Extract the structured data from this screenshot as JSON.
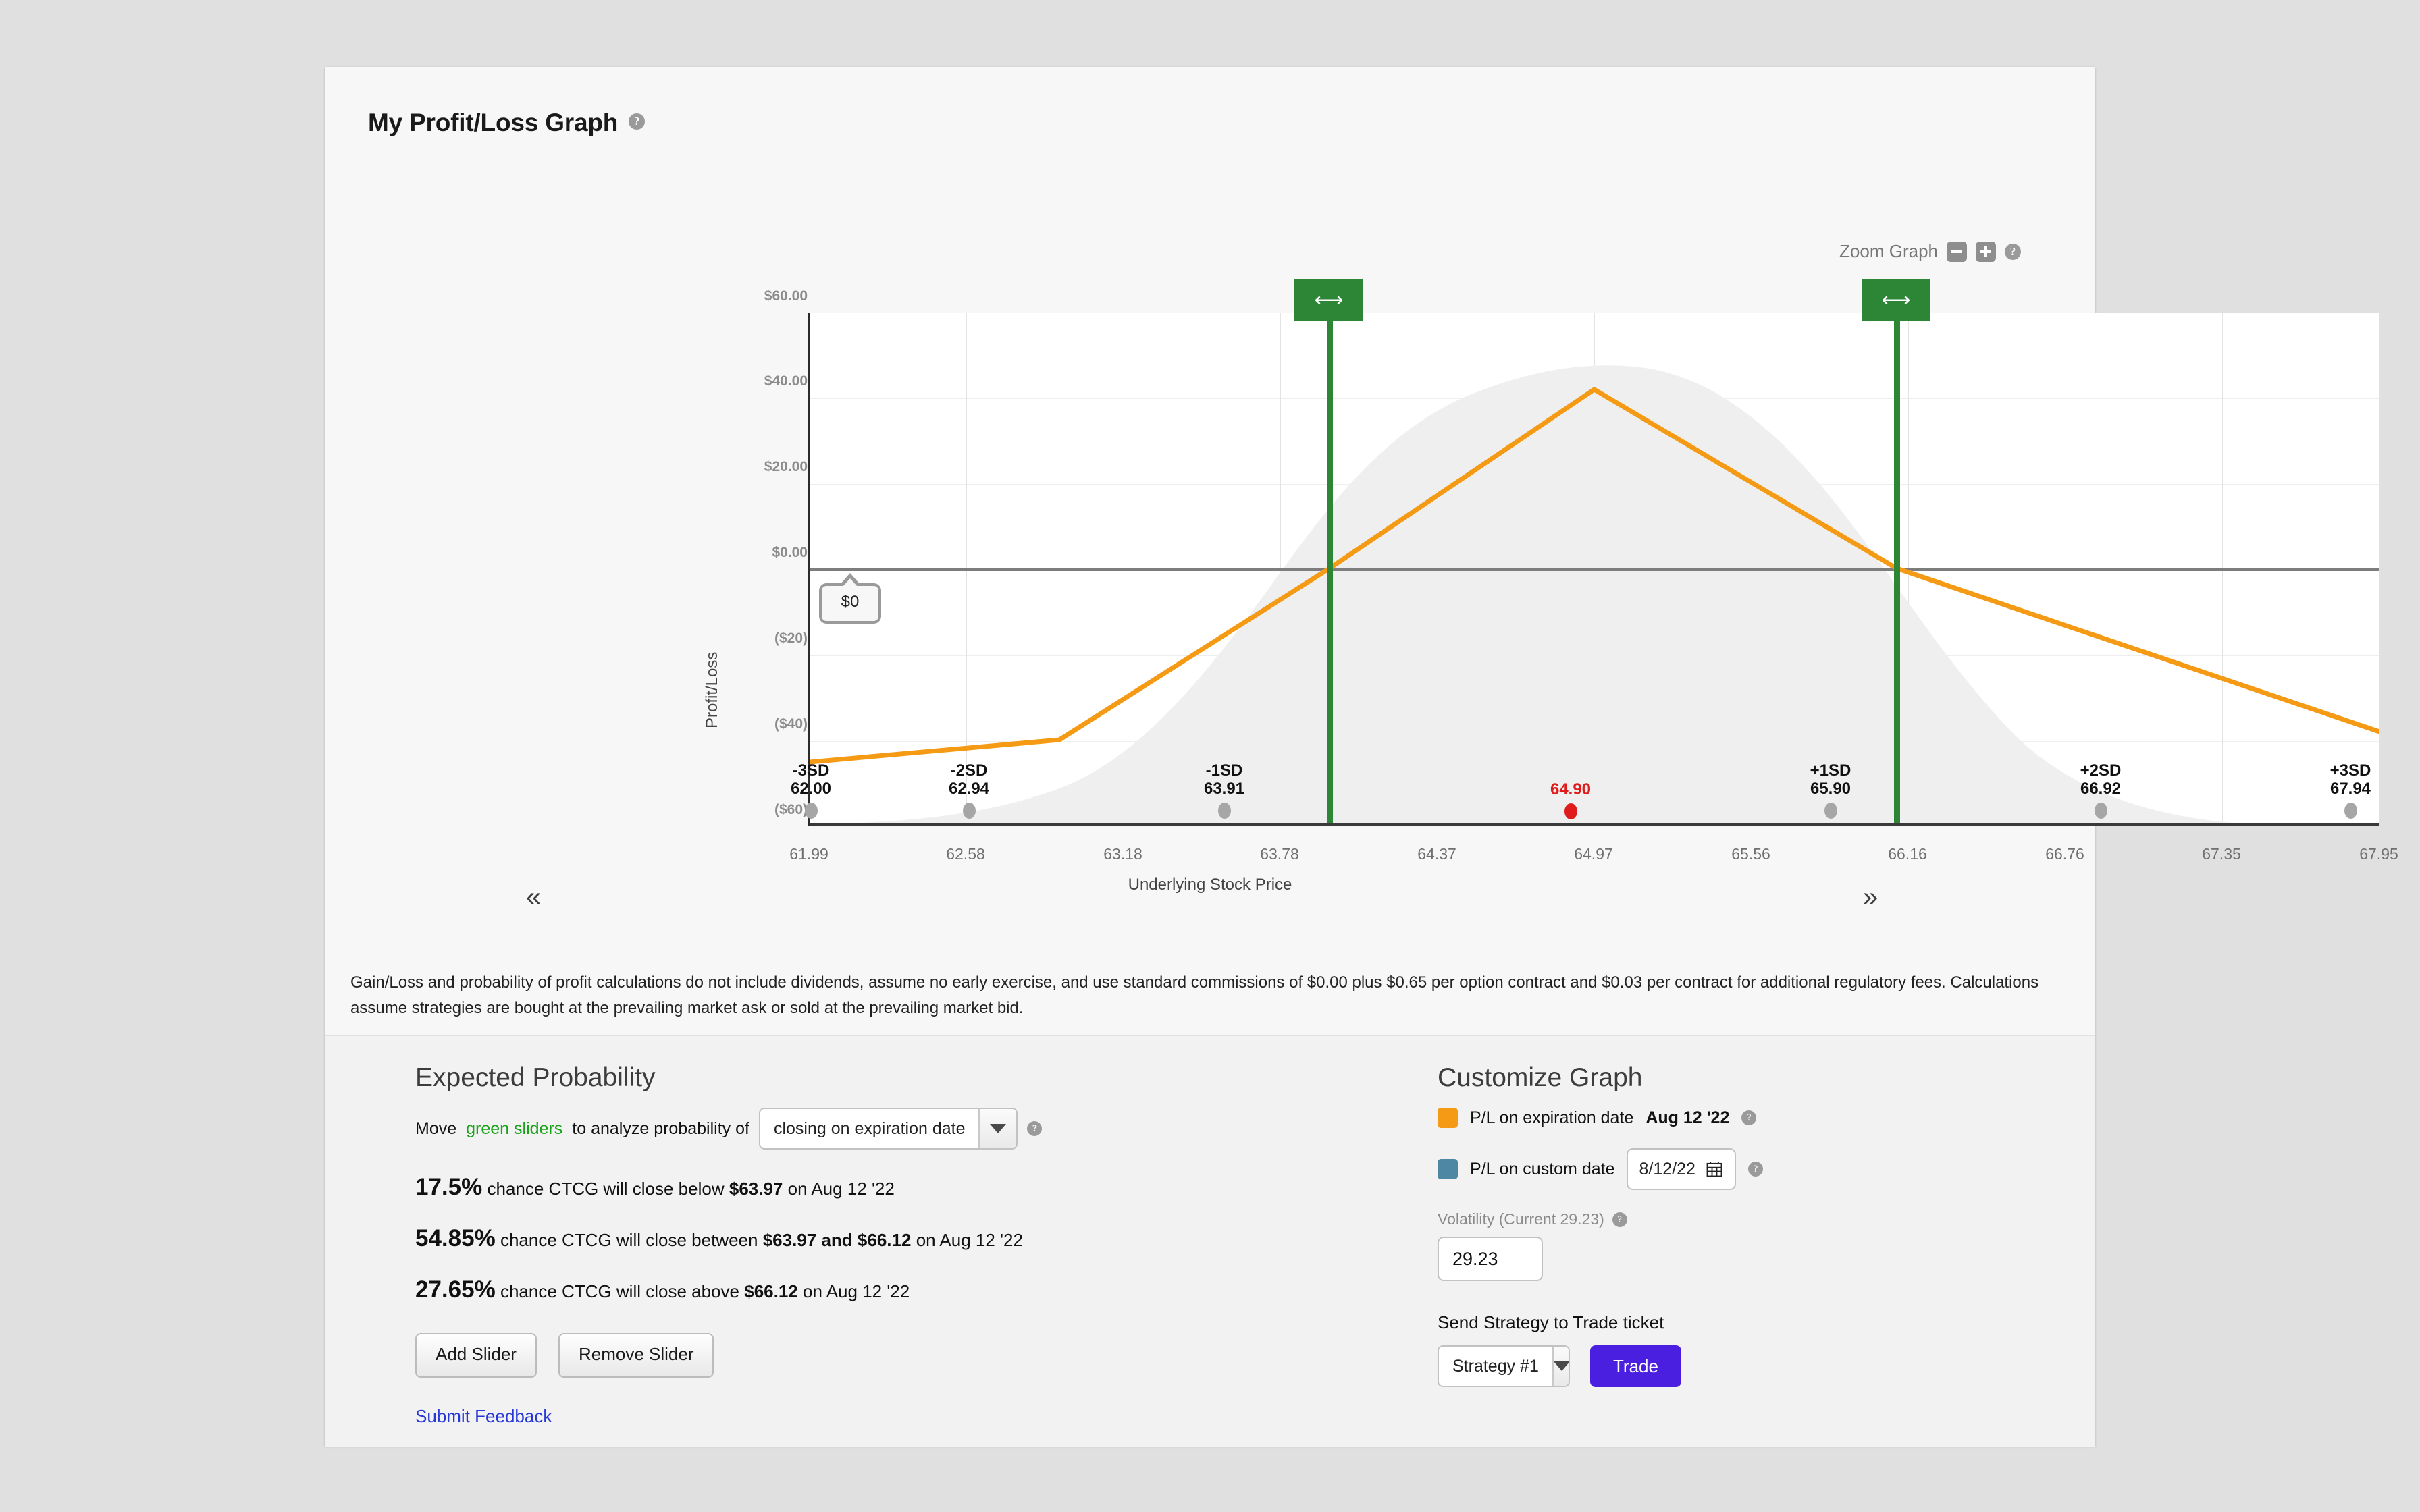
{
  "header": {
    "title": "My Profit/Loss Graph",
    "help_icon": "question-mark-icon",
    "zoom_label": "Zoom Graph",
    "zoom_out_icon": "minus-icon",
    "zoom_in_icon": "plus-icon",
    "zoom_help_icon": "question-mark-icon"
  },
  "chart_data": {
    "type": "line",
    "title": "My Profit/Loss Graph",
    "xlabel": "Underlying Stock Price",
    "ylabel": "Profit/Loss",
    "xlim": [
      61.99,
      67.95
    ],
    "ylim": [
      -60,
      60
    ],
    "grid": true,
    "legend_position": "right-panel",
    "x_ticks": [
      "61.99",
      "62.58",
      "63.18",
      "63.78",
      "64.37",
      "64.97",
      "65.56",
      "66.16",
      "66.76",
      "67.35",
      "67.95"
    ],
    "y_ticks": [
      "$60.00",
      "$40.00",
      "$20.00",
      "$0.00",
      "($20)",
      "($40)",
      "($60)"
    ],
    "y_tick_values": [
      60,
      40,
      20,
      0,
      -20,
      -40,
      -60
    ],
    "zero_callout": "$0",
    "series": [
      {
        "name": "P/L on expiration date Aug 12 '22",
        "color": "#f59a14",
        "x": [
          61.99,
          62.94,
          63.97,
          64.97,
          66.12,
          67.94
        ],
        "values": [
          -45,
          -31,
          0,
          42,
          0,
          -38
        ]
      }
    ],
    "distribution": {
      "name": "probability distribution",
      "color": "#efefef",
      "mean": 64.9,
      "sd": 0.99
    },
    "sd_markers": [
      {
        "label": "-3SD",
        "price": "62.00",
        "current": false
      },
      {
        "label": "-2SD",
        "price": "62.94",
        "current": false
      },
      {
        "label": "-1SD",
        "price": "63.91",
        "current": false
      },
      {
        "label": "",
        "price": "64.90",
        "current": true
      },
      {
        "label": "+1SD",
        "price": "65.90",
        "current": false
      },
      {
        "label": "+2SD",
        "price": "66.92",
        "current": false
      },
      {
        "label": "+3SD",
        "price": "67.94",
        "current": false
      }
    ],
    "sliders": [
      {
        "name": "lower-slider",
        "price": 63.97,
        "color": "#2d8636",
        "icon": "horizontal-resize-icon"
      },
      {
        "name": "upper-slider",
        "price": 66.12,
        "color": "#2d8636",
        "icon": "horizontal-resize-icon"
      }
    ],
    "nav_prev_icon": "«",
    "nav_next_icon": "»"
  },
  "disclaimer": "Gain/Loss and probability of profit calculations do not include dividends, assume no early exercise, and use standard commissions of $0.00 plus $0.65 per option contract and $0.03 per contract for additional regulatory fees. Calculations assume strategies are bought at the prevailing market ask or sold at the prevailing market bid.",
  "expected_probability": {
    "title": "Expected Probability",
    "move_text_prefix": "Move",
    "move_text_green": "green sliders",
    "move_text_suffix": "to analyze probability of",
    "scenario_selected": "closing on expiration date",
    "scenario_help_icon": "question-mark-icon",
    "lines": [
      {
        "pct": "17.5%",
        "text_before": "chance CTCG will close below",
        "value1": "$63.97",
        "text_mid": "",
        "value2": "",
        "text_after": "on Aug 12 '22"
      },
      {
        "pct": "54.85%",
        "text_before": "chance CTCG will close between",
        "value1": "$63.97",
        "text_mid": "and",
        "value2": "$66.12",
        "text_after": "on Aug 12 '22"
      },
      {
        "pct": "27.65%",
        "text_before": "chance CTCG will close above",
        "value1": "$66.12",
        "text_mid": "",
        "value2": "",
        "text_after": "on Aug 12 '22"
      }
    ],
    "add_slider_label": "Add Slider",
    "remove_slider_label": "Remove Slider",
    "feedback_label": "Submit Feedback"
  },
  "customize_graph": {
    "title": "Customize Graph",
    "expiration_swatch_color": "#f59a14",
    "expiration_text": "P/L on expiration date",
    "expiration_date": "Aug 12 '22",
    "expiration_help_icon": "question-mark-icon",
    "custom_swatch_color": "#4d87a4",
    "custom_text": "P/L on custom date",
    "custom_date_value": "8/12/22",
    "calendar_icon": "calendar-icon",
    "custom_help_icon": "question-mark-icon",
    "volatility_label": "Volatility (Current 29.23)",
    "volatility_help_icon": "question-mark-icon",
    "volatility_value": "29.23",
    "send_label": "Send Strategy to Trade ticket",
    "strategy_selected": "Strategy #1",
    "trade_label": "Trade",
    "trade_color": "#4b1fe0"
  }
}
